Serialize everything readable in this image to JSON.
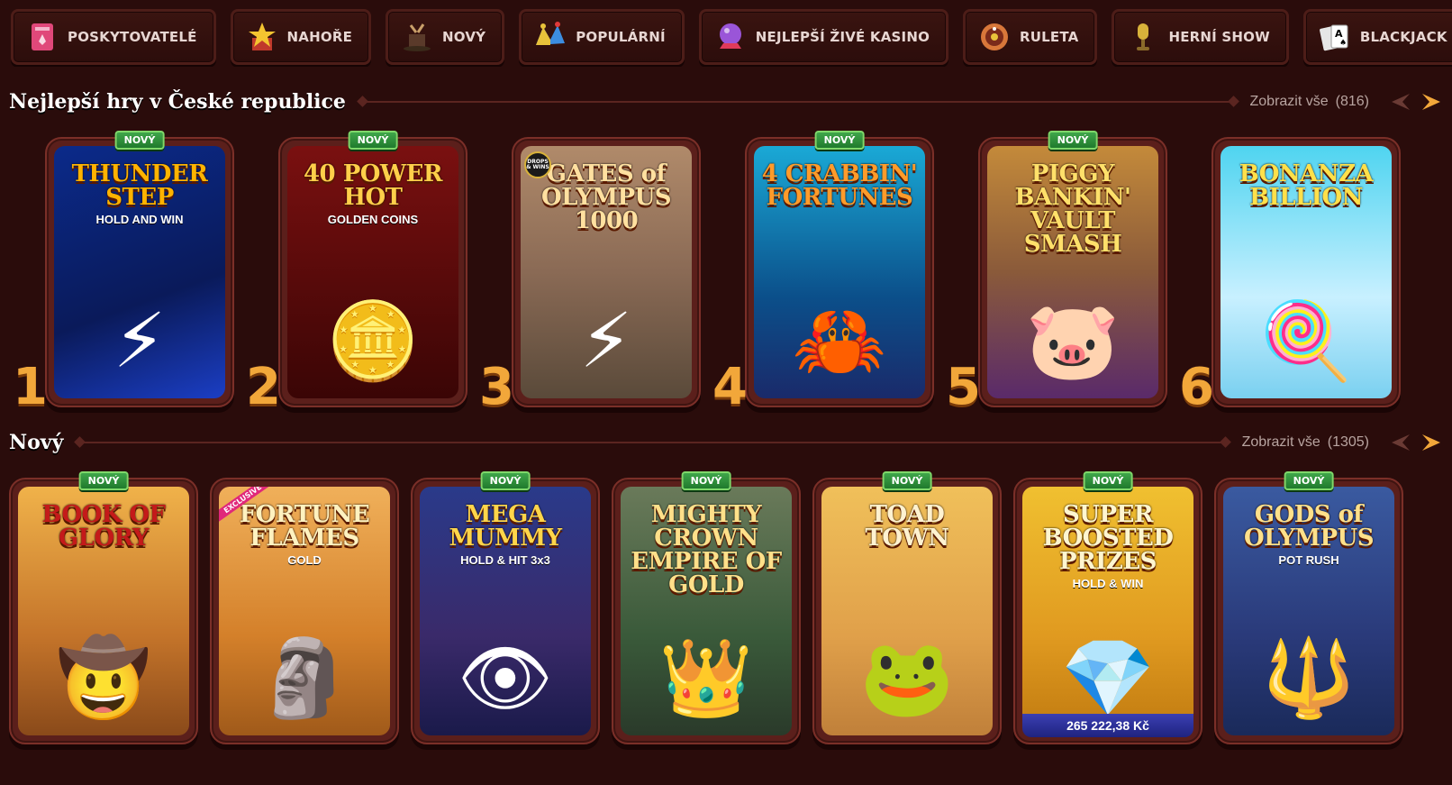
{
  "categories": [
    {
      "label": "Poskytovatelé",
      "icon": "book-icon",
      "color": "#e0487a"
    },
    {
      "label": "Nahoře",
      "icon": "star-box-icon",
      "color": "#f4c430"
    },
    {
      "label": "Nový",
      "icon": "magic-hat-icon",
      "color": "#c9a06a"
    },
    {
      "label": "Populární",
      "icon": "jester-hat-icon",
      "color": "#3c8de0"
    },
    {
      "label": "Nejlepší živé kasino",
      "icon": "crystal-ball-icon",
      "color": "#9a55d8"
    },
    {
      "label": "Ruleta",
      "icon": "roulette-icon",
      "color": "#d8773a"
    },
    {
      "label": "Herní show",
      "icon": "microphone-icon",
      "color": "#d8b23a"
    },
    {
      "label": "Blackjack",
      "icon": "cards-icon",
      "color": "#e6e6e6"
    }
  ],
  "top_section": {
    "title": "Nejlepší hry v České republice",
    "see_all": "Zobrazit vše",
    "count": "(816)",
    "games": [
      {
        "rank": "1",
        "badge": "Nový",
        "title": "THUNDER STEP",
        "sub": "HOLD AND WIN",
        "bg": "linear-gradient(160deg,#0b2a8a,#0a1a5a 60%,#1b3ec4)",
        "title_color": "#ffb300",
        "glyph": "⚡"
      },
      {
        "rank": "2",
        "badge": "Nový",
        "title": "40 POWER HOT",
        "sub": "GOLDEN COINS",
        "bg": "linear-gradient(#7a1010,#3a0505)",
        "title_color": "#ffcf4a",
        "glyph": "🪙"
      },
      {
        "rank": "3",
        "badge": "",
        "title": "GATES of OLYMPUS 1000",
        "sub": "",
        "corner": "DROPS & WINS",
        "bg": "linear-gradient(#b08a6a,#8a6a55 50%,#5a4a3a)",
        "title_color": "#ffe0a0",
        "glyph": "⚡"
      },
      {
        "rank": "4",
        "badge": "Nový",
        "title": "4 CRABBIN' FORTUNES",
        "sub": "",
        "bg": "linear-gradient(#1aa9d6,#0b4f8a 60%,#1a2a6a)",
        "title_color": "#ff9b2a",
        "glyph": "🦀"
      },
      {
        "rank": "5",
        "badge": "Nový",
        "title": "PIGGY BANKIN' VAULT SMASH",
        "sub": "",
        "bg": "linear-gradient(#c48a3a,#8a5a3a 50%,#5a2a6a)",
        "title_color": "#ffe06a",
        "glyph": "🐷"
      },
      {
        "rank": "6",
        "badge": "",
        "title": "BONANZA BILLION",
        "sub": "",
        "bg": "linear-gradient(#4fd4f0,#c8f0ff 60%,#7ad0f0)",
        "title_color": "#ffe04a",
        "glyph": "🍭"
      }
    ]
  },
  "new_section": {
    "title": "Nový",
    "see_all": "Zobrazit vše",
    "count": "(1305)",
    "games": [
      {
        "badge": "Nový",
        "title": "BOOK OF GLORY",
        "sub": "",
        "bg": "linear-gradient(#f0b24a,#c4742a 60%,#8a4a1a)",
        "title_color": "#c41a1a",
        "glyph": "🤠"
      },
      {
        "badge": "",
        "exclusive": "EXCLUSIVE",
        "title": "FORTUNE FLAMES",
        "sub": "GOLD",
        "bg": "linear-gradient(#f0b05a,#d4802a 60%,#a05a1a)",
        "title_color": "#fff2c0",
        "glyph": "🗿"
      },
      {
        "badge": "Nový",
        "title": "MEGA MUMMY",
        "sub": "HOLD & HIT 3x3",
        "bg": "linear-gradient(#2a3a8a,#3a2a6a 60%,#1a1a4a)",
        "title_color": "#ffd54a",
        "glyph": "👁"
      },
      {
        "badge": "Nový",
        "title": "MIGHTY CROWN EMPIRE OF GOLD",
        "sub": "",
        "bg": "linear-gradient(#6a7a5a,#3a5a3a 60%,#2a3a2a)",
        "title_color": "#ffe08a",
        "glyph": "👑"
      },
      {
        "badge": "Nový",
        "title": "TOAD TOWN",
        "sub": "",
        "bg": "linear-gradient(#f0c05a,#e0a04a 60%,#c0803a)",
        "title_color": "#fff2d0",
        "glyph": "🐸"
      },
      {
        "badge": "Nový",
        "title": "SUPER BOOSTED PRIZES",
        "sub": "HOLD & WIN",
        "jackpot": "265 222,38 Kč",
        "bg": "linear-gradient(#f0c030,#e09a20 60%,#c07a10)",
        "title_color": "#fff6d0",
        "glyph": "💎"
      },
      {
        "badge": "Nový",
        "title": "GODS of OLYMPUS",
        "sub": "POT RUSH",
        "bg": "linear-gradient(#3a5aa0,#2a3a7a 60%,#1a2a5a)",
        "title_color": "#ffe08a",
        "glyph": "🔱"
      }
    ]
  }
}
